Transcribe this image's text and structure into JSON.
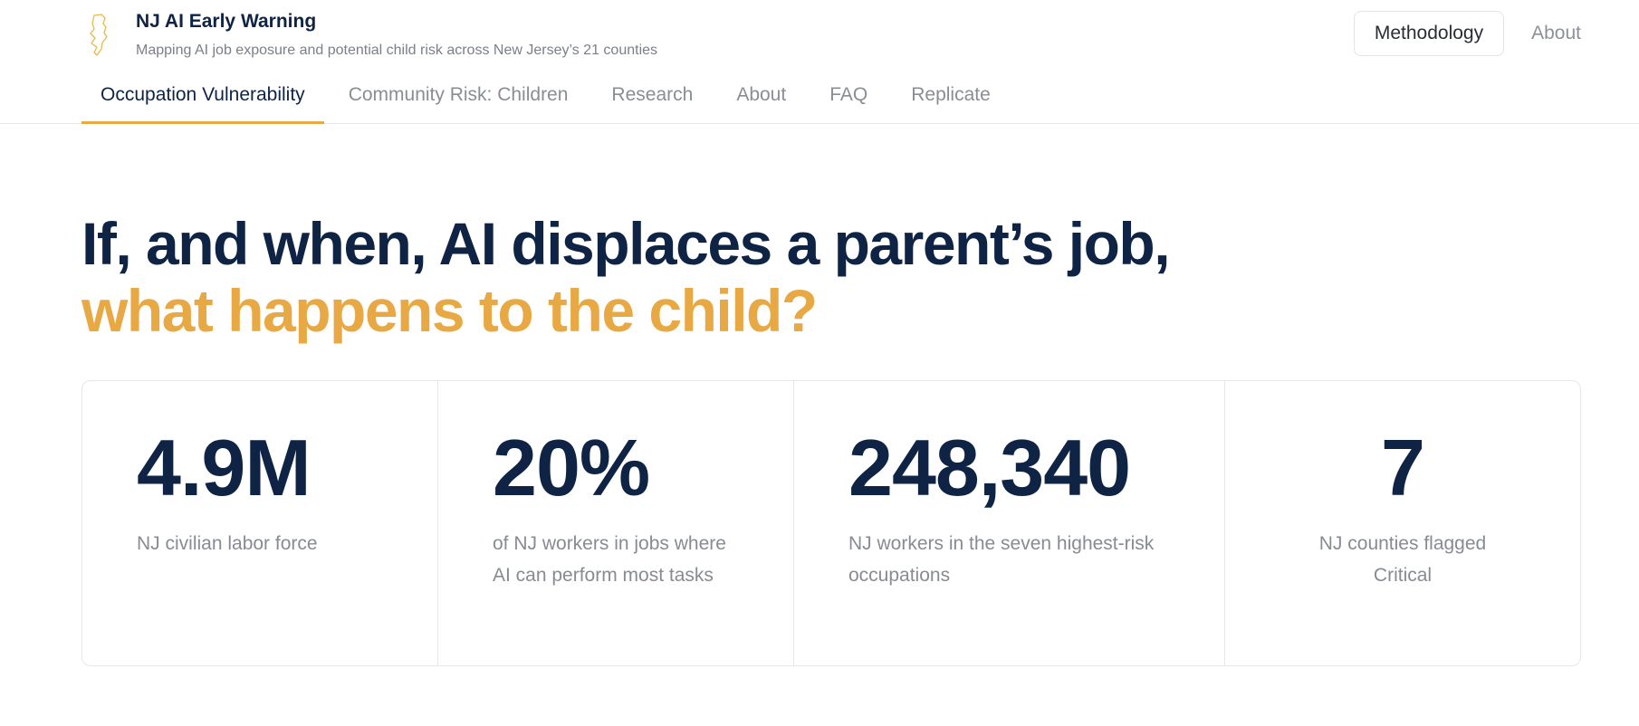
{
  "brand": {
    "title": "NJ AI Early Warning",
    "subtitle": "Mapping AI job exposure and potential child risk across New Jersey’s 21 counties",
    "logo_icon": "new-jersey-outline-icon",
    "accent_color": "#e8a944",
    "primary_color": "#0f2345"
  },
  "top_actions": {
    "methodology": "Methodology",
    "about": "About"
  },
  "tabs": [
    {
      "label": "Occupation Vulnerability",
      "active": true
    },
    {
      "label": "Community Risk: Children",
      "active": false
    },
    {
      "label": "Research",
      "active": false
    },
    {
      "label": "About",
      "active": false
    },
    {
      "label": "FAQ",
      "active": false
    },
    {
      "label": "Replicate",
      "active": false
    }
  ],
  "hero": {
    "line1": "If, and when, AI displaces a parent’s job,",
    "line2": "what happens to the child?"
  },
  "stats": [
    {
      "value": "4.9M",
      "label": "NJ civilian labor force"
    },
    {
      "value": "20%",
      "label": "of NJ workers in jobs where AI can perform most tasks"
    },
    {
      "value": "248,340",
      "label": "NJ workers in the seven highest-risk occupations"
    },
    {
      "value": "7",
      "label": "NJ counties flagged Critical"
    }
  ]
}
